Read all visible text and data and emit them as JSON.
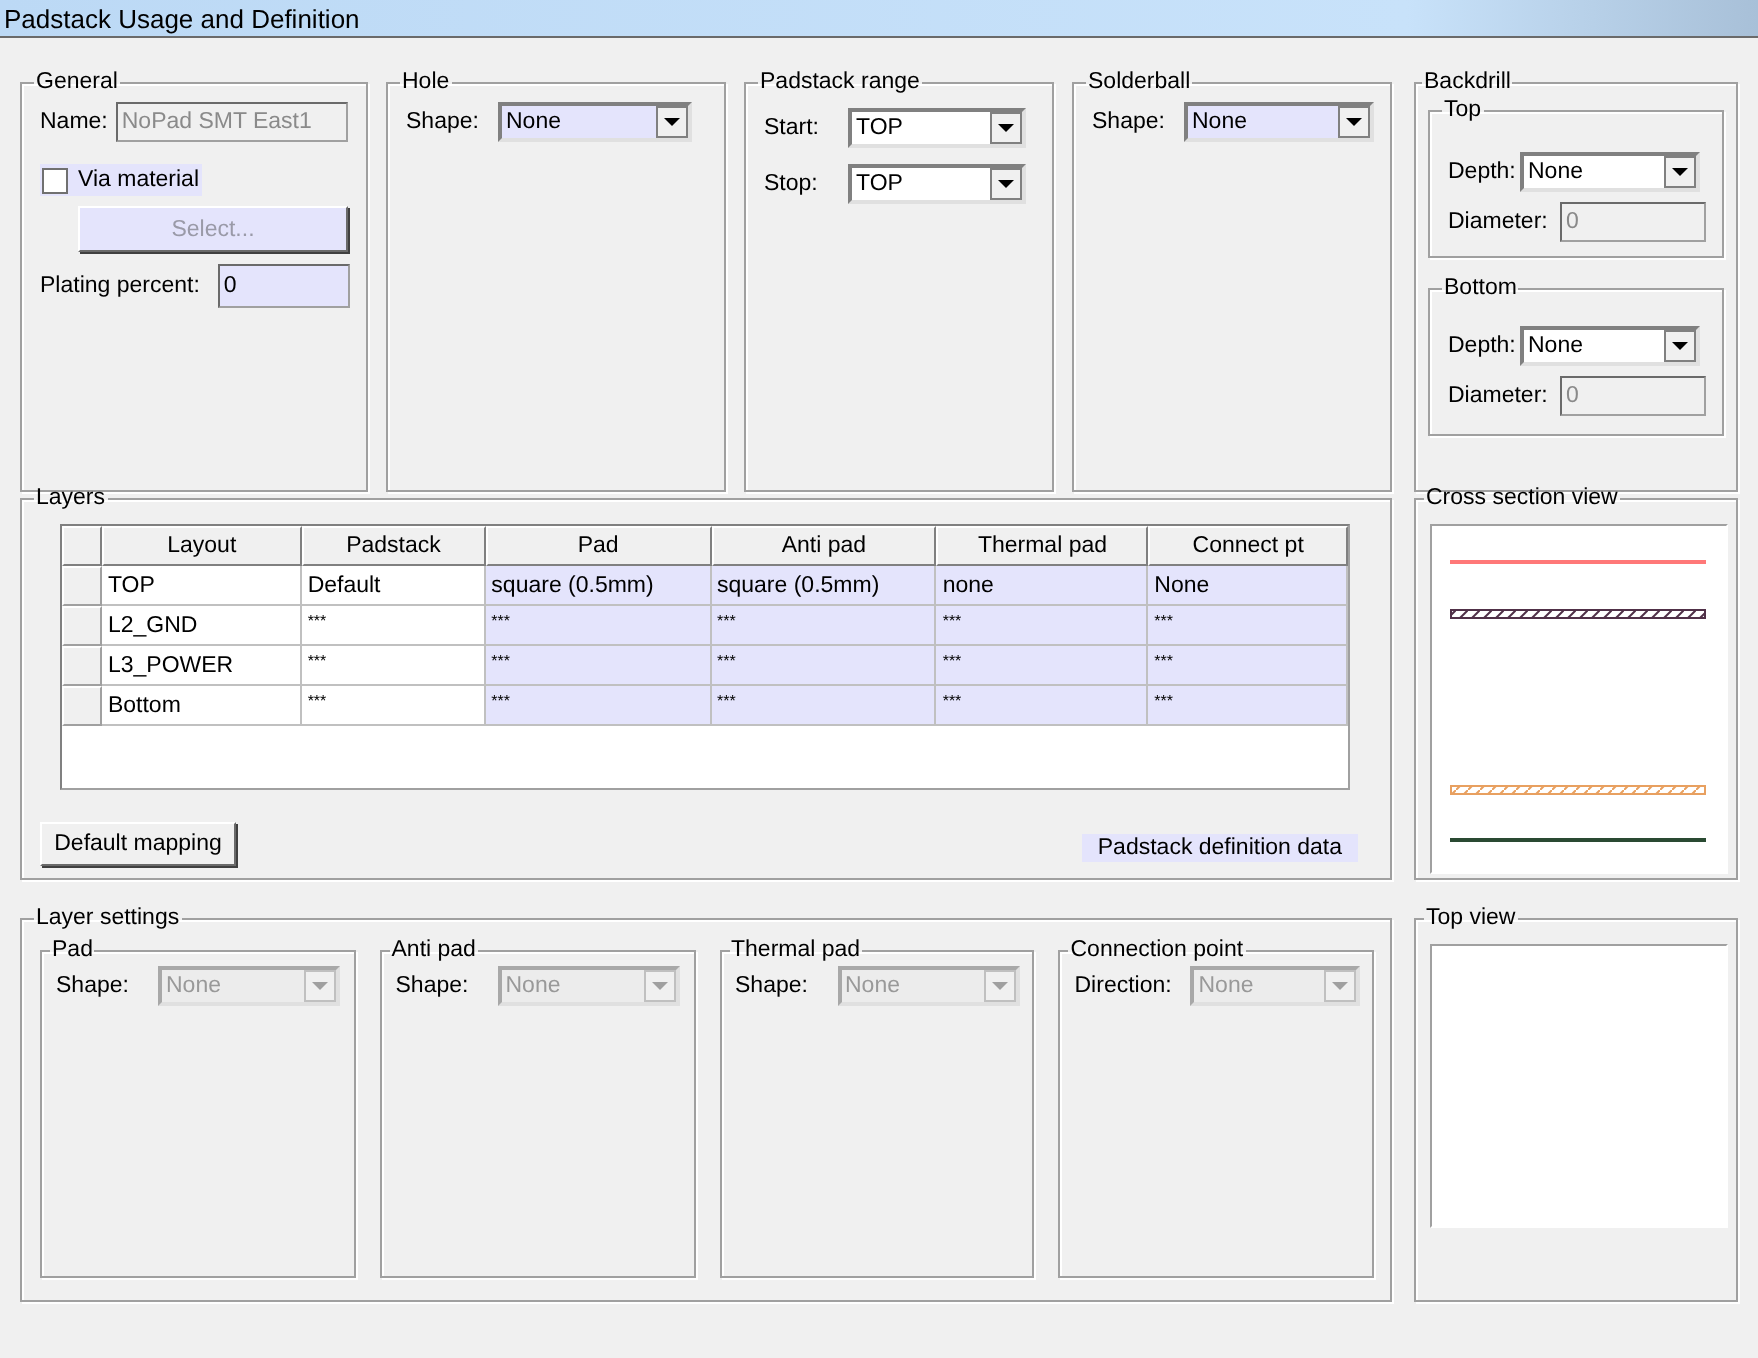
{
  "window": {
    "title": "Padstack Usage and Definition"
  },
  "general": {
    "legend": "General",
    "name_label": "Name:",
    "name_value": "NoPad SMT East1",
    "name_disabled": true,
    "via_material": {
      "label": "Via material",
      "checked": false
    },
    "select_button": {
      "label": "Select...",
      "disabled": true
    },
    "plating_label": "Plating percent:",
    "plating_value": "0"
  },
  "hole": {
    "legend": "Hole",
    "shape_label": "Shape:",
    "shape": {
      "value": "None",
      "highlighted": true,
      "disabled": false
    }
  },
  "padstack_range": {
    "legend": "Padstack range",
    "fields": [
      {
        "label": "Start:",
        "value": "TOP",
        "highlighted": false,
        "disabled": false
      },
      {
        "label": "Stop:",
        "value": "TOP",
        "highlighted": false,
        "disabled": false
      }
    ]
  },
  "solderball": {
    "legend": "Solderball",
    "shape_label": "Shape:",
    "shape": {
      "value": "None",
      "highlighted": true,
      "disabled": false
    }
  },
  "backdrill": {
    "legend": "Backdrill",
    "sections": [
      {
        "legend": "Top",
        "depth_label": "Depth:",
        "depth": {
          "value": "None",
          "highlighted": false,
          "disabled": false
        },
        "diameter_label": "Diameter:",
        "diameter_value": "0",
        "diameter_disabled": true
      },
      {
        "legend": "Bottom",
        "depth_label": "Depth:",
        "depth": {
          "value": "None",
          "highlighted": false,
          "disabled": false
        },
        "diameter_label": "Diameter:",
        "diameter_value": "0",
        "diameter_disabled": true
      }
    ]
  },
  "layers": {
    "legend": "Layers",
    "columns": [
      {
        "label": "Layout",
        "highlighted": false
      },
      {
        "label": "Padstack",
        "highlighted": false
      },
      {
        "label": "Pad",
        "highlighted": true
      },
      {
        "label": "Anti pad",
        "highlighted": true
      },
      {
        "label": "Thermal pad",
        "highlighted": true
      },
      {
        "label": "Connect pt",
        "highlighted": true
      }
    ],
    "rows": [
      {
        "cells": [
          "TOP",
          "Default",
          "square (0.5mm)",
          "square (0.5mm)",
          "none",
          "None"
        ]
      },
      {
        "cells": [
          "L2_GND",
          "***",
          "***",
          "***",
          "***",
          "***"
        ]
      },
      {
        "cells": [
          "L3_POWER",
          "***",
          "***",
          "***",
          "***",
          "***"
        ]
      },
      {
        "cells": [
          "Bottom",
          "***",
          "***",
          "***",
          "***",
          "***"
        ]
      }
    ],
    "default_mapping_button": "Default mapping",
    "definition_label": "Padstack definition data"
  },
  "cross_section": {
    "legend": "Cross section view",
    "layers": [
      {
        "kind": "solid",
        "color": "#ff7878"
      },
      {
        "kind": "hatched",
        "color": "#503048"
      },
      {
        "kind": "hatched",
        "color": "#e8a060"
      },
      {
        "kind": "solid",
        "color": "#2a4a32"
      }
    ]
  },
  "layer_settings": {
    "legend": "Layer settings",
    "groups": [
      {
        "legend": "Pad",
        "label": "Shape:",
        "field": {
          "value": "None",
          "disabled": true
        }
      },
      {
        "legend": "Anti pad",
        "label": "Shape:",
        "field": {
          "value": "None",
          "disabled": true
        }
      },
      {
        "legend": "Thermal pad",
        "label": "Shape:",
        "field": {
          "value": "None",
          "disabled": true
        }
      },
      {
        "legend": "Connection point",
        "label": "Direction:",
        "field": {
          "value": "None",
          "disabled": true
        }
      }
    ]
  },
  "top_view": {
    "legend": "Top view"
  }
}
